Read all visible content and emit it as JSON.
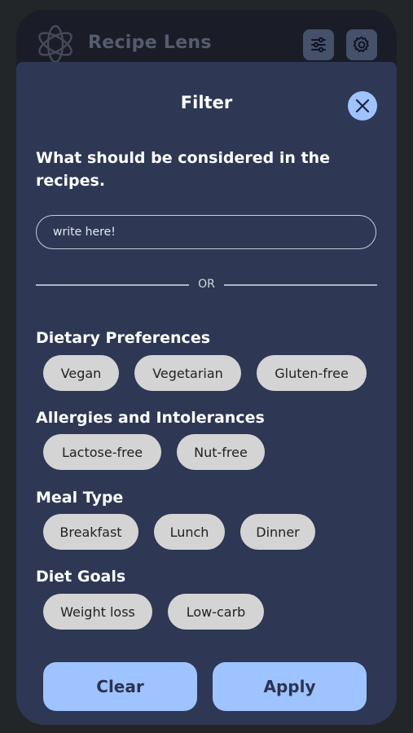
{
  "app": {
    "title": "Recipe Lens"
  },
  "icons": {
    "logo": "app-logo-knot-icon",
    "filter": "sliders-icon",
    "settings": "gear-icon",
    "close": "close-icon"
  },
  "filter": {
    "title": "Filter",
    "prompt": "What should be considered in the recipes.",
    "input_placeholder": "write here!",
    "input_value": "",
    "or_label": "OR",
    "sections": [
      {
        "title": "Dietary Preferences",
        "options": [
          "Vegan",
          "Vegetarian",
          "Gluten-free"
        ]
      },
      {
        "title": "Allergies and Intolerances",
        "options": [
          "Lactose-free",
          "Nut-free"
        ]
      },
      {
        "title": "Meal Type",
        "options": [
          "Breakfast",
          "Lunch",
          "Dinner"
        ]
      },
      {
        "title": "Diet Goals",
        "options": [
          "Weight loss",
          "Low-carb"
        ]
      }
    ],
    "clear_label": "Clear",
    "apply_label": "Apply"
  },
  "colors": {
    "background": "#232628",
    "header": "#1a1d27",
    "sheet": "#2e3754",
    "accent": "#9ec3ff",
    "chip": "#d4d4d4"
  }
}
